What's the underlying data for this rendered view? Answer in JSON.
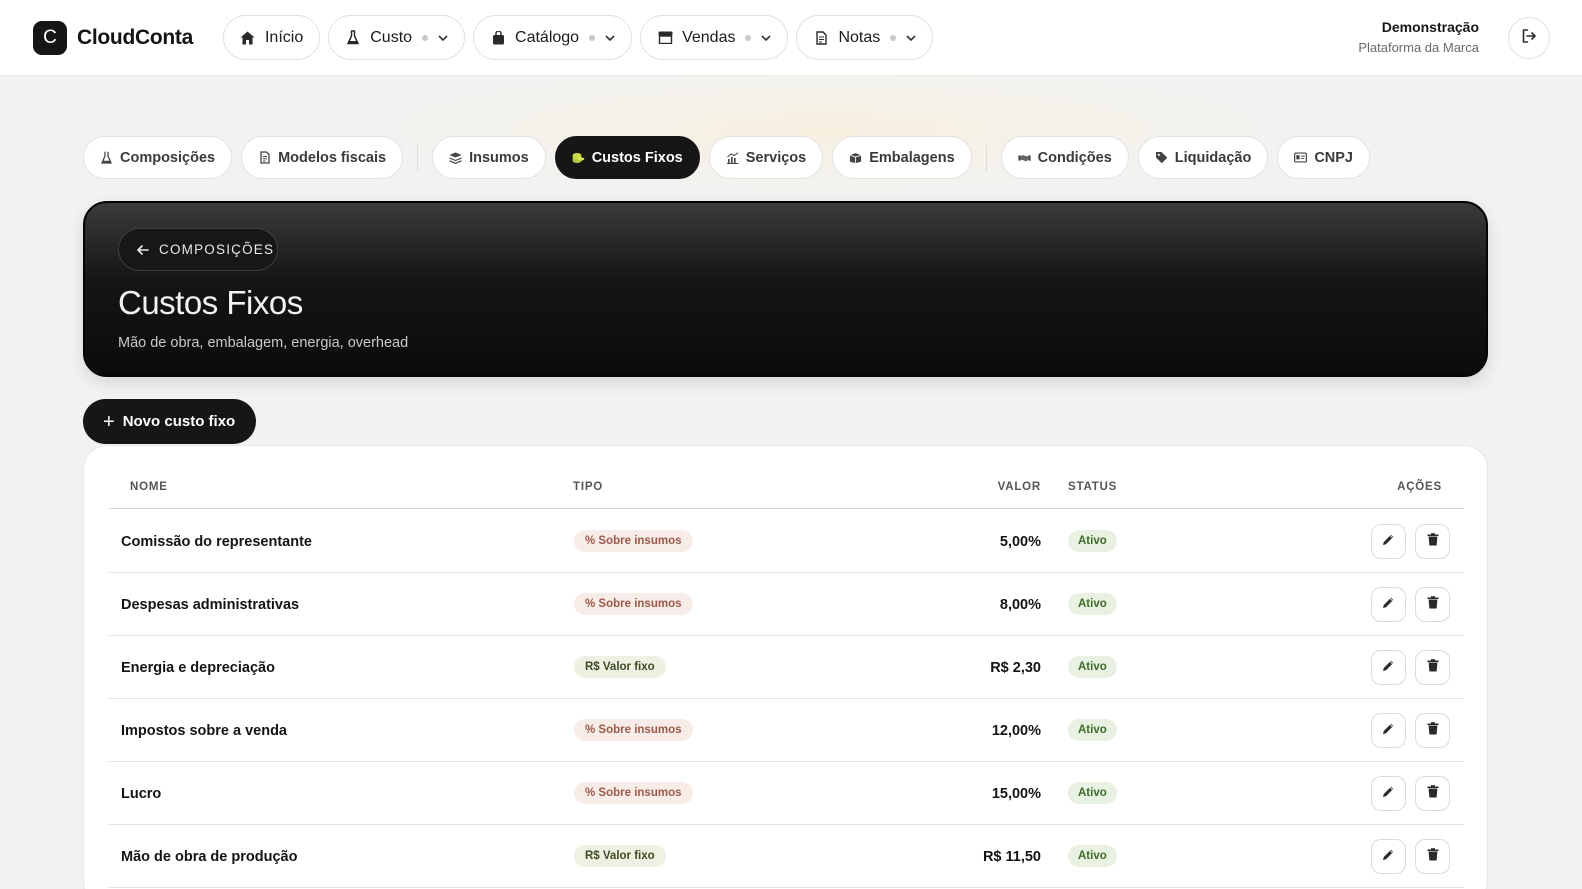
{
  "brand": {
    "logo_letter": "C",
    "name": "CloudConta"
  },
  "topnav": [
    {
      "label": "Início",
      "icon": "home-icon",
      "dropdown": false
    },
    {
      "label": "Custo",
      "icon": "flask-icon",
      "dropdown": true
    },
    {
      "label": "Catálogo",
      "icon": "bag-icon",
      "dropdown": true
    },
    {
      "label": "Vendas",
      "icon": "store-icon",
      "dropdown": true
    },
    {
      "label": "Notas",
      "icon": "document-icon",
      "dropdown": true
    }
  ],
  "user": {
    "name": "Demonstração",
    "subtitle": "Plataforma da Marca"
  },
  "subnav": [
    {
      "label": "Composições",
      "icon": "flask-icon"
    },
    {
      "label": "Modelos fiscais",
      "icon": "document-icon"
    },
    {
      "label": "Insumos",
      "icon": "layers-icon"
    },
    {
      "label": "Custos Fixos",
      "icon": "coins-icon",
      "active": true
    },
    {
      "label": "Serviços",
      "icon": "chart-icon"
    },
    {
      "label": "Embalagens",
      "icon": "box-icon"
    },
    {
      "label": "Condições",
      "icon": "handshake-icon"
    },
    {
      "label": "Liquidação",
      "icon": "tag-icon"
    },
    {
      "label": "CNPJ",
      "icon": "id-card-icon"
    }
  ],
  "hero": {
    "back_label": "COMPOSIÇÕES",
    "title": "Custos Fixos",
    "subtitle": "Mão de obra, embalagem, energia, overhead"
  },
  "new_button": {
    "label": "Novo custo fixo"
  },
  "table": {
    "headers": {
      "name": "NOME",
      "type": "TIPO",
      "value": "VALOR",
      "status": "STATUS",
      "actions": "AÇÕES"
    },
    "rows": [
      {
        "name": "Comissão do representante",
        "type": "% Sobre insumos",
        "kind": "pct",
        "value": "5,00%",
        "status": "Ativo"
      },
      {
        "name": "Despesas administrativas",
        "type": "% Sobre insumos",
        "kind": "pct",
        "value": "8,00%",
        "status": "Ativo"
      },
      {
        "name": "Energia e depreciação",
        "type": "R$ Valor fixo",
        "kind": "fix",
        "value": "R$ 2,30",
        "status": "Ativo"
      },
      {
        "name": "Impostos sobre a venda",
        "type": "% Sobre insumos",
        "kind": "pct",
        "value": "12,00%",
        "status": "Ativo"
      },
      {
        "name": "Lucro",
        "type": "% Sobre insumos",
        "kind": "pct",
        "value": "15,00%",
        "status": "Ativo"
      },
      {
        "name": "Mão de obra de produção",
        "type": "R$ Valor fixo",
        "kind": "fix",
        "value": "R$ 11,50",
        "status": "Ativo"
      }
    ]
  }
}
